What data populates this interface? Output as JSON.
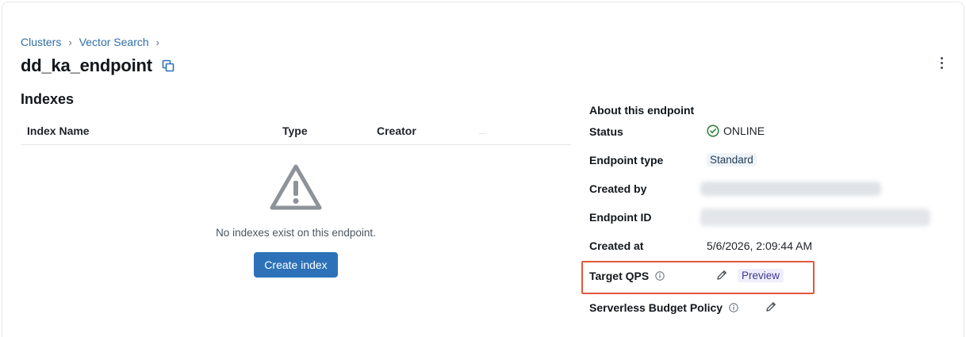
{
  "breadcrumb": {
    "items": [
      "Clusters",
      "Vector Search"
    ],
    "separator": "›"
  },
  "page": {
    "title": "dd_ka_endpoint"
  },
  "indexes": {
    "section_title": "Indexes",
    "columns": [
      "Index Name",
      "Type",
      "Creator"
    ],
    "empty_message": "No indexes exist on this endpoint.",
    "create_button": "Create index"
  },
  "about": {
    "title": "About this endpoint",
    "status_label": "Status",
    "status_value": "ONLINE",
    "endpoint_type_label": "Endpoint type",
    "endpoint_type_value": "Standard",
    "created_by_label": "Created by",
    "endpoint_id_label": "Endpoint ID",
    "created_at_label": "Created at",
    "created_at_value": "5/6/2026, 2:09:44 AM",
    "target_qps_label": "Target QPS",
    "target_qps_tag": "Preview",
    "budget_policy_label": "Serverless Budget Policy"
  },
  "colors": {
    "accent": "#2d72b8",
    "link": "#2f6ea7",
    "online": "#2a7a3b",
    "highlight": "#e2583b"
  }
}
